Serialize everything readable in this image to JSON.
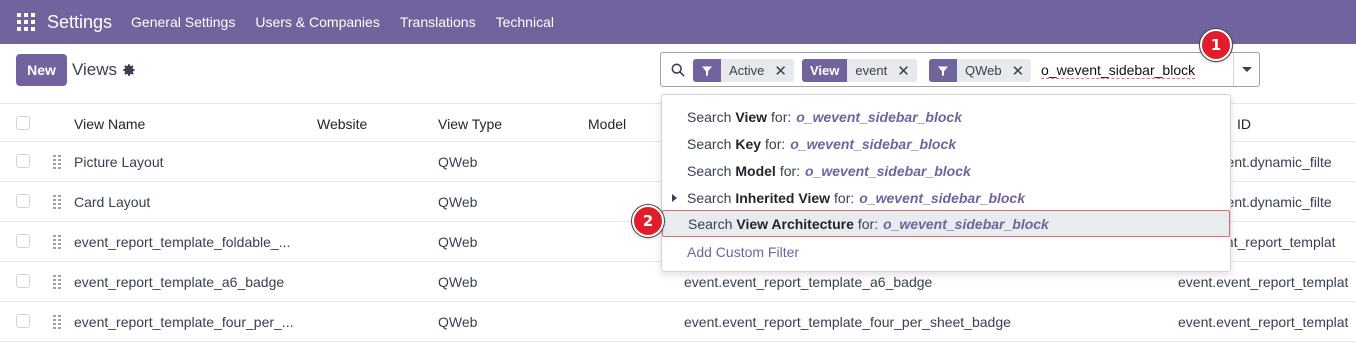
{
  "navbar": {
    "brand": "Settings",
    "items": [
      "General Settings",
      "Users & Companies",
      "Translations",
      "Technical"
    ]
  },
  "control_panel": {
    "new_label": "New",
    "title": "Views"
  },
  "search": {
    "facets": [
      {
        "tag_type": "filter-icon",
        "value": "Active"
      },
      {
        "tag_label": "View",
        "value": "event"
      },
      {
        "tag_type": "filter-icon",
        "value": "QWeb"
      }
    ],
    "query": "o_wevent_sidebar_block",
    "dropdown": {
      "items": [
        {
          "prefix": "Search",
          "field": "View",
          "suffix": "for:",
          "term": "o_wevent_sidebar_block",
          "expandable": false
        },
        {
          "prefix": "Search",
          "field": "Key",
          "suffix": "for:",
          "term": "o_wevent_sidebar_block",
          "expandable": false
        },
        {
          "prefix": "Search",
          "field": "Model",
          "suffix": "for:",
          "term": "o_wevent_sidebar_block",
          "expandable": false
        },
        {
          "prefix": "Search",
          "field": "Inherited View",
          "suffix": "for:",
          "term": "o_wevent_sidebar_block",
          "expandable": true
        },
        {
          "prefix": "Search",
          "field": "View Architecture",
          "suffix": "for:",
          "term": "o_wevent_sidebar_block",
          "expandable": false,
          "highlighted": true
        }
      ],
      "custom_filter": "Add Custom Filter"
    }
  },
  "table": {
    "columns": [
      "View Name",
      "Website",
      "View Type",
      "Model",
      "ID"
    ],
    "rows": [
      {
        "name": "Picture Layout",
        "type": "QWeb",
        "model": "",
        "external_id": "_event.dynamic_filte"
      },
      {
        "name": "Card Layout",
        "type": "QWeb",
        "model": "",
        "external_id": "_event.dynamic_filte"
      },
      {
        "name": "event_report_template_foldable_...",
        "type": "QWeb",
        "model": "",
        "external_id": "ent_report_templat"
      },
      {
        "name": "event_report_template_a6_badge",
        "type": "QWeb",
        "model": "event.event_report_template_a6_badge",
        "external_id": "event.event_report_templat"
      },
      {
        "name": "event_report_template_four_per_...",
        "type": "QWeb",
        "model": "event.event_report_template_four_per_sheet_badge",
        "external_id": "event.event_report_templat"
      }
    ]
  },
  "markers": [
    "1",
    "2"
  ],
  "colors": {
    "navbar": "#71639e",
    "accent": "#71639e",
    "marker": "#e11d2a"
  }
}
